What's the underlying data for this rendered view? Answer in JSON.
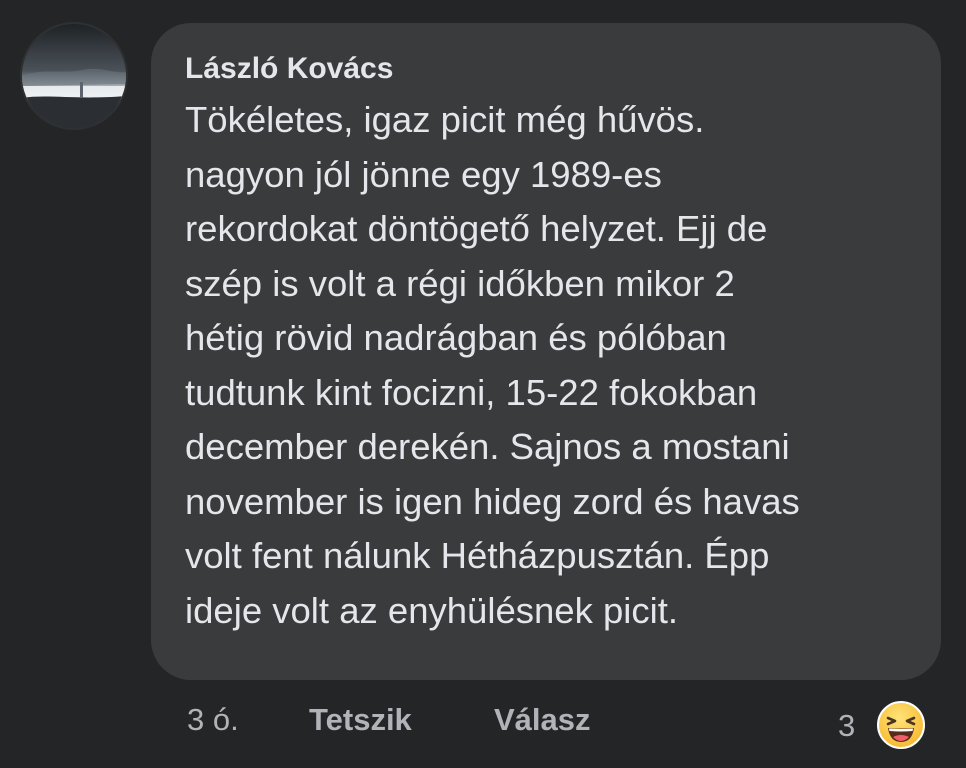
{
  "comment": {
    "author": "László Kovács",
    "avatar_icon": "landscape-photo-avatar",
    "text_lines": [
      "Tökéletes, igaz picit még hűvös.",
      "nagyon jól jönne egy 1989-es",
      "rekordokat döntögető helyzet. Ejj de",
      "szép is volt a régi időkben mikor 2",
      "hétig rövid nadrágban és pólóban",
      "tudtunk kint focizni, 15-22 fokokban",
      "december derekén. Sajnos a mostani",
      "november is igen hideg zord és havas",
      "volt fent nálunk Hétházpusztán. Épp",
      "ideje volt az enyhülésnek picit."
    ]
  },
  "actions": {
    "timestamp": "3 ó.",
    "like_label": "Tetszik",
    "reply_label": "Válasz",
    "reaction_count": "3",
    "reaction_icon": "haha-emoji-icon"
  },
  "colors": {
    "background": "#242526",
    "bubble": "#3a3b3c",
    "primary_text": "#e4e6eb",
    "secondary_text": "#b0b3b8",
    "reaction_yellow": "#f7c948"
  }
}
